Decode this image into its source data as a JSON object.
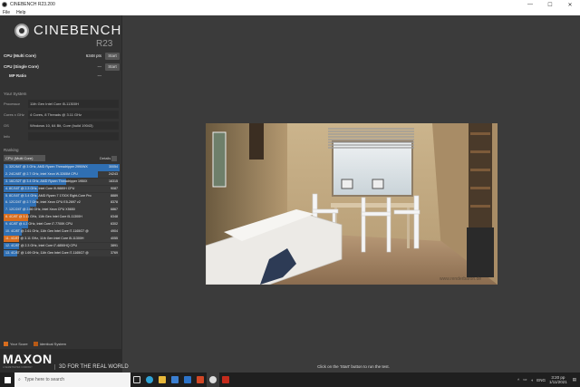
{
  "window": {
    "title": "CINEBENCH R23.200",
    "minimize": "—",
    "maximize": "☐",
    "close": "✕"
  },
  "menu": [
    "File",
    "Help"
  ],
  "logo": {
    "name": "CINEBENCH",
    "version": "R23"
  },
  "benchmarks": [
    {
      "label": "CPU (Multi Core)",
      "score": "6348 pts",
      "button": "Start"
    },
    {
      "label": "CPU (Single Core)",
      "score": "---",
      "button": "Start"
    },
    {
      "label": "MP Ratio",
      "score": "---",
      "button": ""
    }
  ],
  "system": {
    "title": "Your System",
    "rows": [
      {
        "key": "Processor",
        "value": "11th Gen Intel Core i5-11300H"
      },
      {
        "key": "Cores x GHz",
        "value": "4 Cores, 8 Threads @ 3.11 GHz"
      },
      {
        "key": "OS",
        "value": "Windows 10, 64 Bit, Core (build 19043)"
      },
      {
        "key": "Info",
        "value": ""
      }
    ]
  },
  "ranking": {
    "title": "Ranking",
    "selected": "CPU (Multi Core)",
    "details_label": "Details",
    "items": [
      {
        "text": "1. 32C/64T @ 3 GHz, AMD Ryzen Threadripper 2990WX",
        "value": "30054",
        "fill": 1.0,
        "highlight": false
      },
      {
        "text": "2. 24C/48T @ 2.7 GHz, Intel Xeon W-3265M CPU",
        "value": "24243",
        "fill": 0.81,
        "highlight": false
      },
      {
        "text": "3. 16C/32T @ 3.4 GHz, AMD Ryzen Threadripper 1950X",
        "value": "16315",
        "fill": 0.54,
        "highlight": false
      },
      {
        "text": "4. 8C/16T @ 2.3 GHz, Intel Core i9-9880H CPU",
        "value": "9087",
        "fill": 0.3,
        "highlight": false
      },
      {
        "text": "5. 8C/16T @ 3.4 GHz, AMD Ryzen 7 1700X Eight-Core Pro",
        "value": "8889",
        "fill": 0.3,
        "highlight": false
      },
      {
        "text": "6. 12C/24T @ 2.7 GHz, Intel Xeon CPU E5-2697 v2",
        "value": "8378",
        "fill": 0.28,
        "highlight": false
      },
      {
        "text": "7. 12C/24T @ 2.66 GHz, Intel Xeon CPU X5650",
        "value": "6867",
        "fill": 0.23,
        "highlight": false
      },
      {
        "text": "8. 4C/8T @ 3.11 GHz, 11th Gen Intel Core i5-11300H",
        "value": "6348",
        "fill": 0.21,
        "highlight": true
      },
      {
        "text": "9. 4C/8T @ 4.2 GHz, Intel Core i7-7700K CPU",
        "value": "6302",
        "fill": 0.21,
        "highlight": false
      },
      {
        "text": "10. 4C/8T @ 2.61 GHz, 11th Gen Intel Core i7-1165G7 @",
        "value": "4904",
        "fill": 0.16,
        "highlight": false
      },
      {
        "text": "11. 4C/8T @ 3.11 GHz, 11th Gen Intel Core i5-11300H",
        "value": "4055",
        "fill": 0.13,
        "highlight": true
      },
      {
        "text": "12. 4C/8T @ 2.3 GHz, Intel Core i7-4850HQ CPU",
        "value": "3891",
        "fill": 0.13,
        "highlight": false
      },
      {
        "text": "13. 4C/8T @ 1.69 GHz, 11th Gen Intel Core i7-1165G7 @",
        "value": "3769",
        "fill": 0.12,
        "highlight": false
      }
    ]
  },
  "legend": {
    "your_score": "Your Score",
    "identical": "Identical System",
    "your_color": "#d86d1e",
    "identical_color": "#b85a16"
  },
  "footer": {
    "brand": "MAXON",
    "brand_sub": "A NEMETSCHEK COMPANY",
    "tagline": "3D FOR THE REAL WORLD",
    "hint": "Click on the 'Start' button to run the test."
  },
  "render": {
    "watermark": "www.renderbaron.de"
  },
  "taskbar": {
    "search_placeholder": "Type here to search",
    "apps": [
      "task-view",
      "edge",
      "file-explorer",
      "store",
      "mail",
      "office",
      "cinebench",
      "acrobat"
    ],
    "lang": "ENG",
    "time": "3:20 pp",
    "date": "1/11/2021"
  },
  "colors": {
    "accent_blue": "#2f6fb3",
    "accent_orange": "#d86d1e",
    "bg": "#3b3b3b"
  }
}
